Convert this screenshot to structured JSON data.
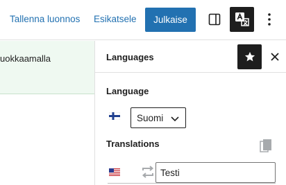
{
  "toolbar": {
    "save_draft_label": "Tallenna luonnos",
    "preview_label": "Esikatsele",
    "publish_label": "Julkaise",
    "accent_color": "#2271b1"
  },
  "notice": {
    "text": "uokkaamalla"
  },
  "sidebar": {
    "title": "Languages",
    "language_section": {
      "label": "Language",
      "flag": "finland-flag",
      "selected": "Suomi"
    },
    "translations_section": {
      "label": "Translations",
      "rows": [
        {
          "flag": "us-flag",
          "value": "Testi"
        }
      ]
    }
  },
  "icons": {
    "sidebar_toggle": "sidebar-toggle-icon",
    "translate": "translate-icon",
    "more": "more-vertical-icon",
    "pin": "star-icon",
    "close": "close-icon",
    "copy": "copy-icon",
    "sync": "sync-icon",
    "chevron": "chevron-down-icon"
  }
}
